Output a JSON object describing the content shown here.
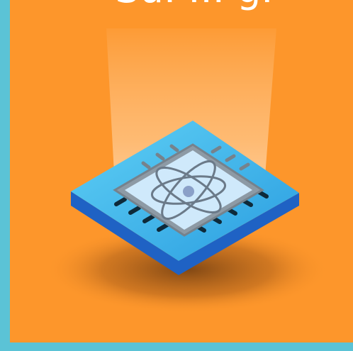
{
  "slide": {
    "heading_fragment": "Su. ... g.",
    "background_color": "#fd962b",
    "border_color": "#5bc3d6"
  },
  "illustration": {
    "subject": "quantum-chip-icon",
    "symbol": "atom-icon",
    "chip_color": "#2fa7e0",
    "base_color": "#1f62c4"
  }
}
